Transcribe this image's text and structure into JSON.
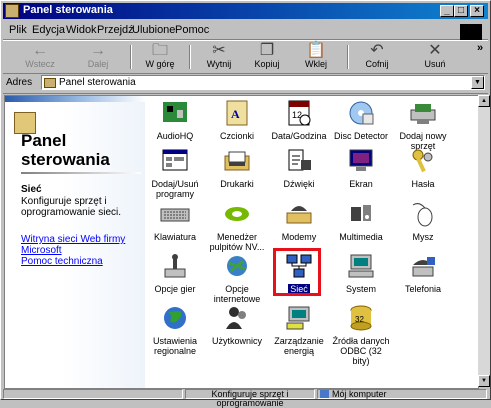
{
  "window": {
    "title": "Panel sterowania"
  },
  "menu": [
    "Plik",
    "Edycja",
    "Widok",
    "Przejdź",
    "Ulubione",
    "Pomoc"
  ],
  "toolbar": {
    "back": "Wstecz",
    "forward": "Dalej",
    "up": "W górę",
    "cut": "Wytnij",
    "copy": "Kopiuj",
    "paste": "Wklej",
    "undo": "Cofnij",
    "delete": "Usuń",
    "more": "»"
  },
  "address": {
    "label": "Adres",
    "value": "Panel sterowania"
  },
  "sidebar": {
    "title": "Panel sterowania",
    "selected_name": "Sieć",
    "selected_desc": "Konfiguruje sprzęt i oprogramowanie sieci.",
    "link1": "Witryna sieci Web firmy Microsoft",
    "link2": "Pomoc techniczna"
  },
  "items": [
    {
      "label": "AudioHQ"
    },
    {
      "label": "Czcionki"
    },
    {
      "label": "Data/Godzina"
    },
    {
      "label": "Disc Detector"
    },
    {
      "label": "Dodaj nowy sprzęt"
    },
    {
      "label": "Dodaj/Usuń programy"
    },
    {
      "label": "Drukarki"
    },
    {
      "label": "Dźwięki"
    },
    {
      "label": "Ekran"
    },
    {
      "label": "Hasła"
    },
    {
      "label": "Klawiatura"
    },
    {
      "label": "Menedżer pulpitów NV..."
    },
    {
      "label": "Modemy"
    },
    {
      "label": "Multimedia"
    },
    {
      "label": "Mysz"
    },
    {
      "label": "Opcje gier"
    },
    {
      "label": "Opcje internetowe"
    },
    {
      "label": "Sieć"
    },
    {
      "label": "System"
    },
    {
      "label": "Telefonia"
    },
    {
      "label": "Ustawienia regionalne"
    },
    {
      "label": "Użytkownicy"
    },
    {
      "label": "Zarządzanie energią"
    },
    {
      "label": "Źródła danych ODBC (32 bity)"
    }
  ],
  "status": {
    "description": "Konfiguruje sprzęt i oprogramowanie",
    "zone": "Mój komputer"
  }
}
